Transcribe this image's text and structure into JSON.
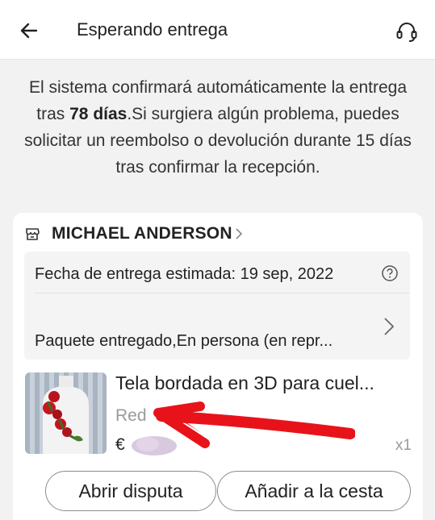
{
  "header": {
    "title": "Esperando entrega",
    "back_icon": "back-arrow-icon",
    "support_icon": "headset-icon"
  },
  "notice": {
    "part1": "El sistema confirmará automáticamente la entrega tras ",
    "days": "78 días",
    "part2": ".Si surgiera algún problema, puedes solicitar un reembolso o devolución durante 15 días tras confirmar la recepción."
  },
  "order": {
    "store_name": "MICHAEL ANDERSON",
    "store_icon": "store-icon",
    "eta_text": "Fecha de entrega estimada: 19 sep, 2022",
    "package_status": "Paquete entregado,En persona (en repr...",
    "product": {
      "title": "Tela bordada en 3D para cuel...",
      "variant": "Red",
      "currency": "€",
      "quantity": "x1"
    },
    "actions": {
      "dispute_label": "Abrir disputa",
      "cart_label": "Añadir a la cesta"
    }
  },
  "colors": {
    "background": "#f2f2f2",
    "card": "#ffffff",
    "annotation_red": "#e8131a",
    "muted_text": "#9a9a9a"
  }
}
